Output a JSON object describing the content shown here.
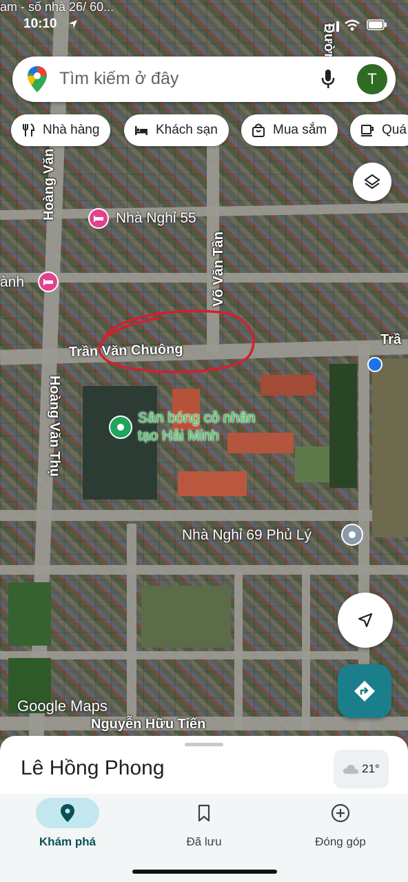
{
  "status": {
    "time": "10:10",
    "top_partial_text": "am - số nhà 26/ 60..."
  },
  "search": {
    "placeholder": "Tìm kiếm ở đây",
    "avatar_letter": "T"
  },
  "chips": [
    {
      "label": "Nhà hàng",
      "icon": "restaurant-icon"
    },
    {
      "label": "Khách sạn",
      "icon": "hotel-icon"
    },
    {
      "label": "Mua sắm",
      "icon": "shopping-bag-icon"
    },
    {
      "label": "Quá",
      "icon": "cafe-icon"
    }
  ],
  "map": {
    "places": [
      {
        "label": "Nhà Nghỉ 55",
        "type": "hotel"
      },
      {
        "label": "ành",
        "type": "hotel"
      },
      {
        "label": "Sân bóng cỏ nhân tạo Hải Minh",
        "line1": "Sân bóng cỏ nhân",
        "line2": "tạo Hải Minh",
        "type": "park"
      },
      {
        "label": "Nhà Nghỉ 69 Phủ Lý",
        "type": "place"
      }
    ],
    "roads": {
      "hoang_van_thu_top": "Hoàng Văn",
      "hoang_van_thu": "Hoàng Văn Thụ",
      "vo_van_tan": "Võ Văn Tần",
      "tran_van_chuong": "Trần Văn Chuông",
      "tran_right": "Trầ",
      "duong_top": "Đường",
      "nguyen_huu_tien": "Nguyễn Hữu Tiến"
    },
    "watermark": "Google Maps",
    "annotation_color": "#d2202f"
  },
  "sheet": {
    "title": "Lê Hồng Phong",
    "weather": "21°"
  },
  "nav": [
    {
      "label": "Khám phá",
      "icon": "explore-pin-icon",
      "active": true
    },
    {
      "label": "Đã lưu",
      "icon": "bookmark-icon",
      "active": false
    },
    {
      "label": "Đóng góp",
      "icon": "add-circle-icon",
      "active": false
    }
  ],
  "colors": {
    "accent_teal": "#1a7f8a",
    "active_pill": "#c2e7ef",
    "hotel_pin": "#e3418f",
    "park_pin": "#1fa55a"
  }
}
